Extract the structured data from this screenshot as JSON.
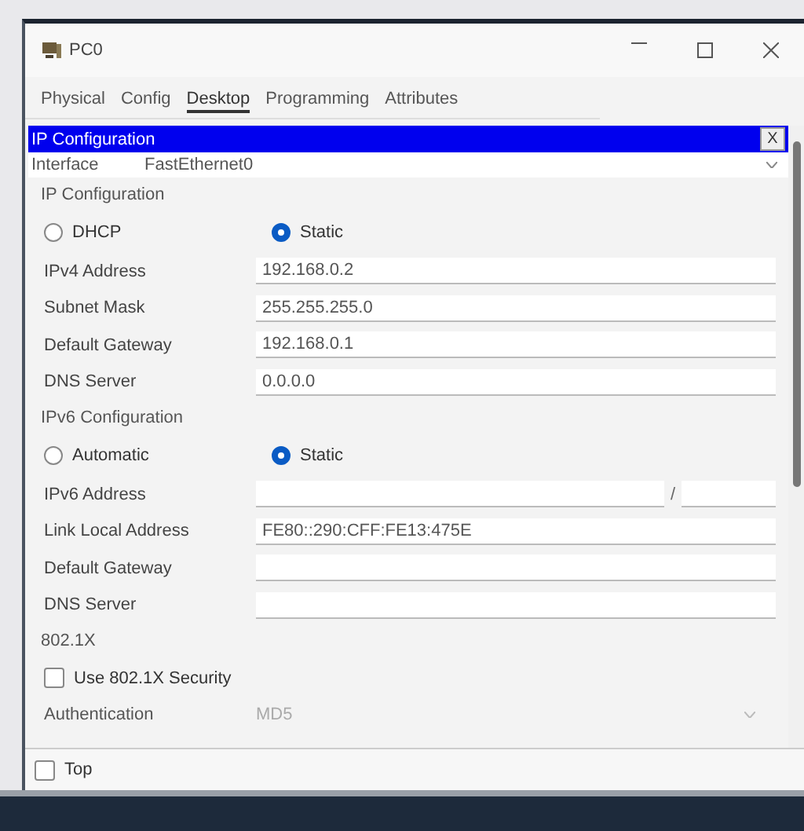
{
  "window": {
    "title": "PC0"
  },
  "tabs": [
    {
      "label": "Physical",
      "selected": false
    },
    {
      "label": "Config",
      "selected": false
    },
    {
      "label": "Desktop",
      "selected": true
    },
    {
      "label": "Programming",
      "selected": false
    },
    {
      "label": "Attributes",
      "selected": false
    }
  ],
  "panel": {
    "title": "IP Configuration",
    "close": "X"
  },
  "interface": {
    "label": "Interface",
    "value": "FastEthernet0"
  },
  "ipv4": {
    "heading": "IP Configuration",
    "modes": [
      {
        "label": "DHCP",
        "selected": false
      },
      {
        "label": "Static",
        "selected": true
      }
    ],
    "fields": [
      {
        "label": "IPv4 Address",
        "kind": "text",
        "value": "192.168.0.2"
      },
      {
        "label": "Subnet Mask",
        "kind": "text",
        "value": "255.255.255.0"
      },
      {
        "label": "Default Gateway",
        "kind": "text",
        "value": "192.168.0.1"
      },
      {
        "label": "DNS Server",
        "kind": "text",
        "value": "0.0.0.0"
      }
    ]
  },
  "ipv6": {
    "heading": "IPv6 Configuration",
    "modes": [
      {
        "label": "Automatic",
        "selected": false
      },
      {
        "label": "Static",
        "selected": true
      }
    ],
    "fields": [
      {
        "label": "IPv6 Address",
        "kind": "prefix",
        "separator": "/"
      },
      {
        "label": "Link Local Address",
        "kind": "text",
        "value": "FE80::290:CFF:FE13:475E"
      },
      {
        "label": "Default Gateway",
        "kind": "text"
      },
      {
        "label": "DNS Server",
        "kind": "text"
      }
    ]
  },
  "dot1x": {
    "heading": "802.1X",
    "security": {
      "label": "Use 802.1X Security",
      "checked": false
    },
    "authentication": {
      "label": "Authentication",
      "value": "MD5",
      "disabled": true
    }
  },
  "footer": {
    "top": {
      "label": "Top",
      "checked": false
    }
  }
}
